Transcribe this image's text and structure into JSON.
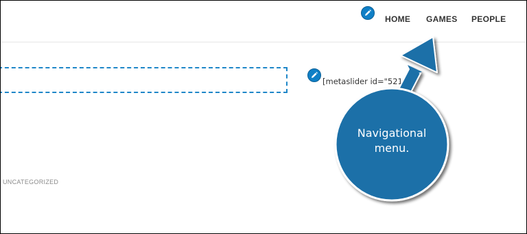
{
  "header": {
    "nav": {
      "items": [
        {
          "label": "HOME"
        },
        {
          "label": "GAMES"
        },
        {
          "label": "PEOPLE"
        }
      ]
    }
  },
  "main": {
    "shortcode_text": "[metaslider id=\"521\"]",
    "category_label": "UNCATEGORIZED"
  },
  "callout": {
    "text_line1": "Navigational",
    "text_line2": "menu."
  },
  "icons": {
    "edit": "pencil-icon"
  },
  "colors": {
    "accent": "#0f7fc6",
    "callout_fill": "#1a6fa8",
    "dashed_border": "#1d86c8",
    "nav_text": "#333333"
  }
}
